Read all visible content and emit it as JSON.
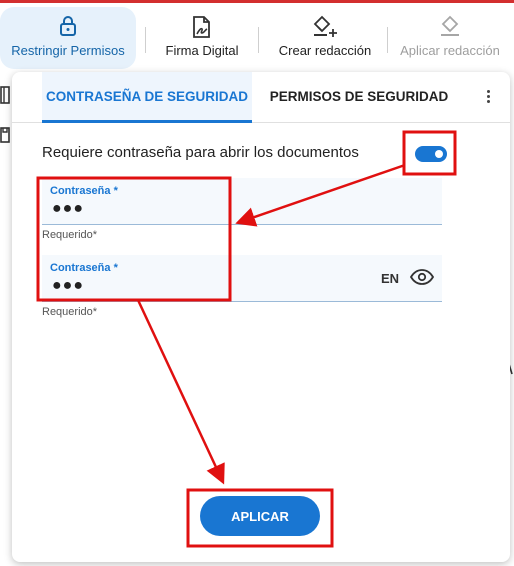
{
  "toolbar": {
    "items": [
      {
        "label": "Restringir Permisos",
        "icon": "lock-icon",
        "active": true
      },
      {
        "label": "Firma Digital",
        "icon": "signature-icon",
        "active": false
      },
      {
        "label": "Crear redacción",
        "icon": "eraser-plus-icon",
        "active": false
      },
      {
        "label": "Aplicar redacción",
        "icon": "eraser-icon",
        "active": false,
        "disabled": true
      }
    ]
  },
  "dialog": {
    "tabs": [
      {
        "label": "CONTRASEÑA DE SEGURIDAD",
        "active": true
      },
      {
        "label": "PERMISOS DE SEGURIDAD",
        "active": false
      }
    ],
    "menu_icon": "more-vert-icon",
    "require_password": {
      "label": "Requiere contraseña para abrir los documentos",
      "enabled": true
    },
    "fields": [
      {
        "label": "Contraseña *",
        "value": "●●●",
        "helper": "Requerido*"
      },
      {
        "label": "Contraseña *",
        "value": "●●●",
        "helper": "Requerido*",
        "language": "EN",
        "toggle_icon": "eye-icon"
      }
    ],
    "apply_label": "APLICAR"
  },
  "colors": {
    "accent": "#1976d2",
    "active_tab_bg": "#eef5fd",
    "annotation": "#e01010"
  }
}
